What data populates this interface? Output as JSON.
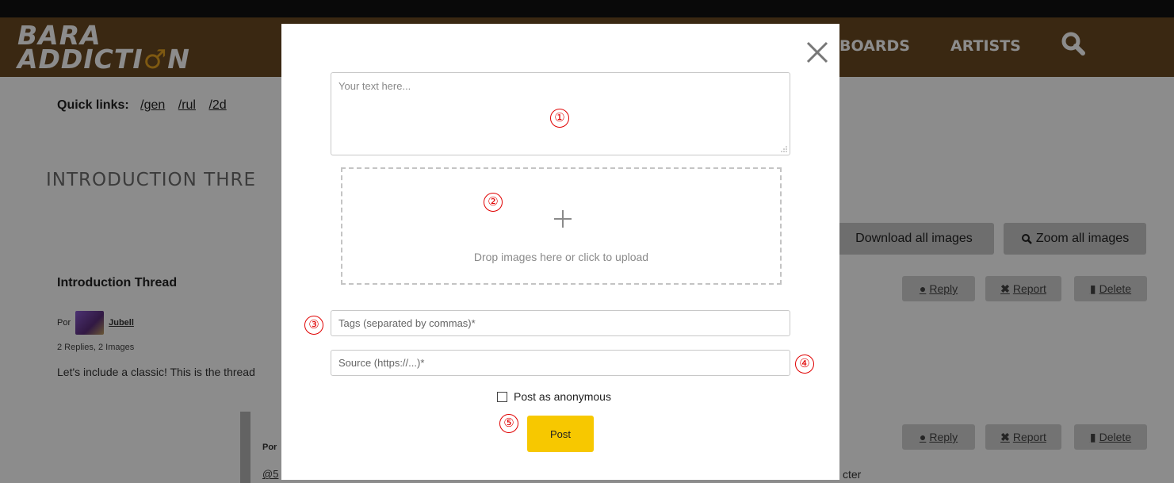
{
  "site": {
    "logo_line1": "BARA",
    "logo_line2": "ADDICTI",
    "logo_mars": "♂",
    "logo_end": "N"
  },
  "nav": {
    "boards": "BOARDS",
    "artists": "ARTISTS",
    "search_icon": "search-icon"
  },
  "quicklinks": {
    "label": "Quick links:",
    "links": [
      "/gen",
      "/rul",
      "/2d"
    ]
  },
  "thread": {
    "title_visible": "INTRODUCTION THRE",
    "download_all": "Download all images",
    "zoom_all": "Zoom all images",
    "post_title": "Introduction Thread",
    "by_label": "Por",
    "author": "Jubell",
    "meta": "2 Replies, 2 Images",
    "text_visible": "Let's include a classic! This is the thread",
    "reply_label": "Reply",
    "report_label": "Report",
    "delete_label": "Delete"
  },
  "reply": {
    "by_label": "Por",
    "mention_visible": "@5",
    "text_tail": "cter"
  },
  "modal": {
    "textarea_placeholder": "Your text here...",
    "dropzone_text": "Drop images here or click to upload",
    "tags_placeholder": "Tags (separated by commas)*",
    "source_placeholder": "Source (https://...)*",
    "anonymous_label": "Post as anonymous",
    "anonymous_checked": false,
    "post_label": "Post"
  },
  "markers": [
    "①",
    "②",
    "③",
    "④",
    "⑤"
  ],
  "colors": {
    "navbar": "#6b4a22",
    "post_button": "#f7c800",
    "marker": "#e00000",
    "logo_accent": "#e6a21f"
  }
}
